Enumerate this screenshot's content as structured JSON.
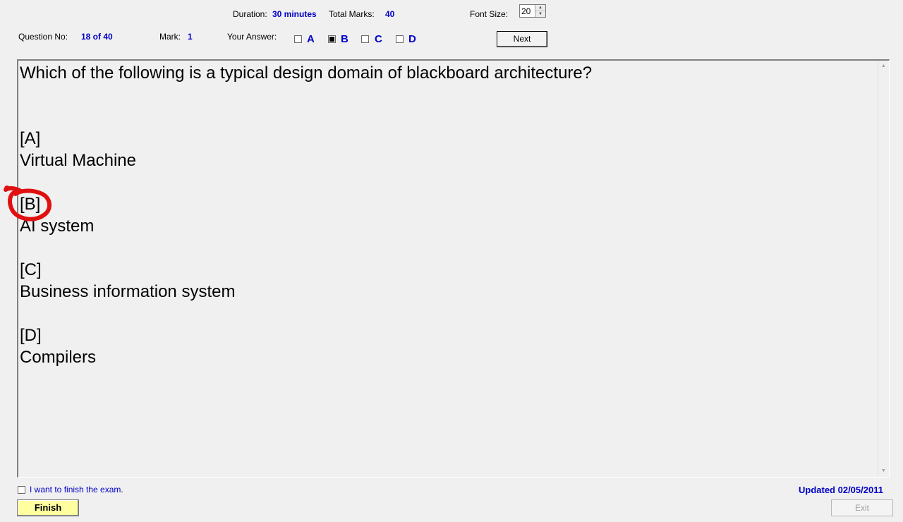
{
  "header": {
    "duration_label": "Duration:",
    "duration_value": "30 minutes",
    "total_marks_label": "Total Marks:",
    "total_marks_value": "40",
    "font_size_label": "Font Size:",
    "font_size_value": "20",
    "question_no_label": "Question No:",
    "question_no_value": "18 of 40",
    "mark_label": "Mark:",
    "mark_value": "1",
    "your_answer_label": "Your Answer:",
    "answer_options": [
      {
        "label": "A",
        "checked": false
      },
      {
        "label": "B",
        "checked": true
      },
      {
        "label": "C",
        "checked": false
      },
      {
        "label": "D",
        "checked": false
      }
    ],
    "next_label": "Next"
  },
  "question": {
    "text": "Which of the following is a typical design domain of blackboard architecture?",
    "options": [
      {
        "letter": "[A]",
        "text": "Virtual Machine"
      },
      {
        "letter": "[B]",
        "text": "AI system"
      },
      {
        "letter": "[C]",
        "text": "Business information system"
      },
      {
        "letter": "[D]",
        "text": "Compilers"
      }
    ]
  },
  "footer": {
    "finish_checkbox_label": "I want to finish the exam.",
    "finish_checked": false,
    "finish_label": "Finish",
    "updated_text": "Updated 02/05/2011",
    "exit_label": "Exit"
  },
  "colors": {
    "accent_blue": "#0000c8",
    "finish_button_bg": "#ffffa0",
    "annotation_red": "#e01010"
  },
  "icons": {
    "spin_up": "spin-up-icon",
    "spin_down": "spin-down-icon",
    "scroll_up": "scroll-up-arrow-icon",
    "scroll_down": "scroll-down-arrow-icon",
    "annotation": "red-circle-annotation"
  }
}
